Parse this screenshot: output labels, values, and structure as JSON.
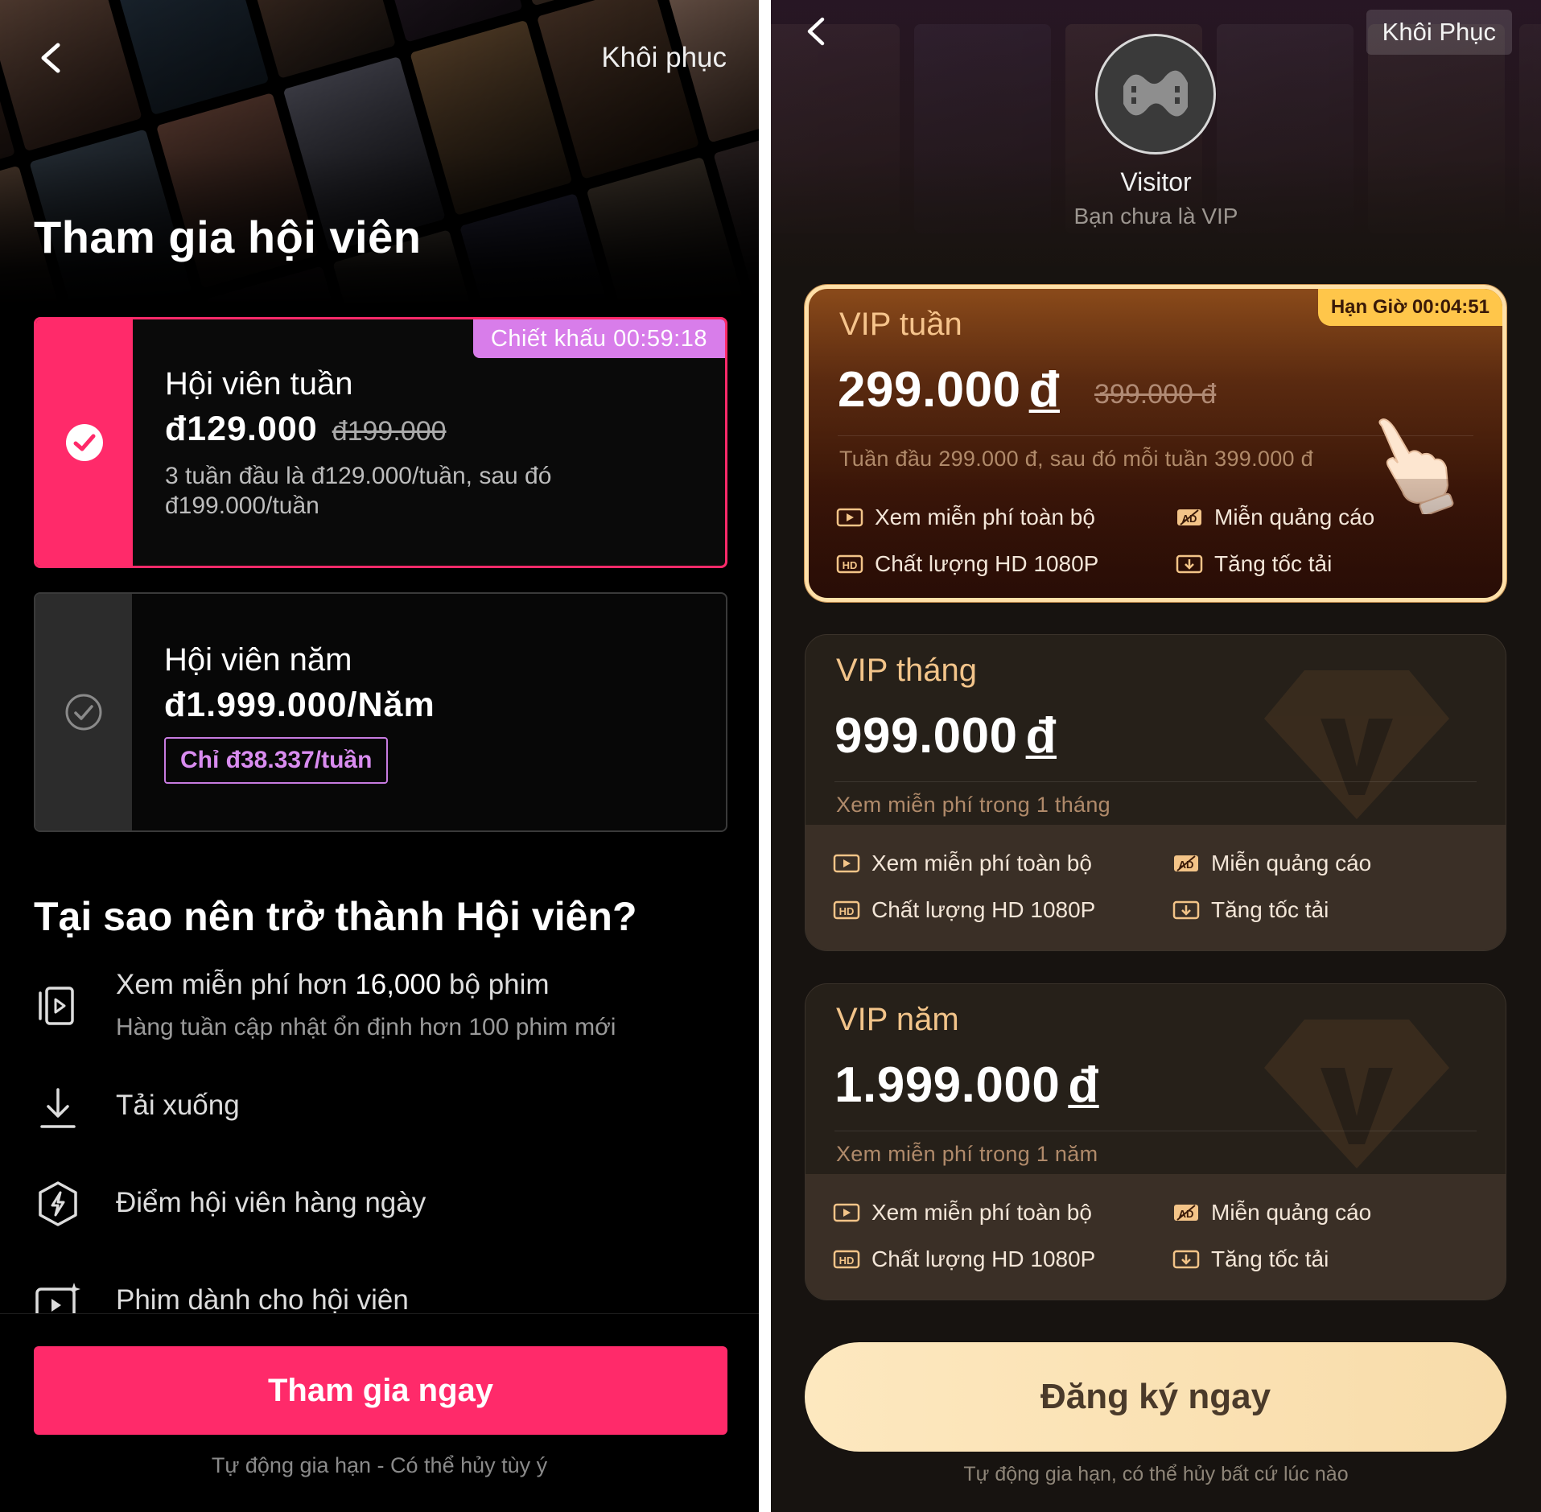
{
  "left": {
    "restore_label": "Khôi phục",
    "title": "Tham gia hội viên",
    "plans": [
      {
        "name": "Hội viên tuần",
        "price": "đ129.000",
        "old_price": "đ199.000",
        "description": "3 tuần đầu là đ129.000/tuần, sau đó đ199.000/tuần",
        "discount_tag": "Chiết khấu 00:59:18",
        "selected": true
      },
      {
        "name": "Hội viên năm",
        "price": "đ1.999.000/Năm",
        "per_week": "Chỉ đ38.337/tuần",
        "selected": false
      }
    ],
    "why_title": "Tại sao nên trở thành Hội viên?",
    "benefits": [
      {
        "pre": "Xem miễn phí hơn ",
        "strong": "16,000",
        "post": " bộ phim",
        "sub": "Hàng tuần cập nhật ổn định hơn 100 phim mới",
        "icon": "video-library-icon"
      },
      {
        "text": "Tải xuống",
        "icon": "download-icon"
      },
      {
        "text": "Điểm hội viên hàng ngày",
        "icon": "points-badge-icon"
      },
      {
        "text": "Phim dành cho hội viên",
        "icon": "exclusive-video-icon"
      }
    ],
    "join_button": "Tham gia ngay",
    "auto_renew": "Tự động gia hạn - Có thể hủy tùy ý",
    "colors": {
      "accent": "#ff2a6a",
      "tag": "#d87dea"
    }
  },
  "right": {
    "restore_label": "Khôi Phục",
    "username": "Visitor",
    "vip_status": "Bạn chưa là VIP",
    "plans": [
      {
        "name": "VIP tuần",
        "price": "299.000",
        "currency": "đ",
        "old_price": "399.000 đ",
        "subtitle": "Tuần đầu 299.000 đ, sau đó mỗi tuần 399.000 đ",
        "deadline_tag": "Hạn Giờ 00:04:51",
        "selected": true
      },
      {
        "name": "VIP tháng",
        "price": "999.000",
        "currency": "đ",
        "subtitle": "Xem miễn phí trong 1 tháng",
        "selected": false
      },
      {
        "name": "VIP năm",
        "price": "1.999.000",
        "currency": "đ",
        "subtitle": "Xem miễn phí trong 1 năm",
        "selected": false
      }
    ],
    "features": {
      "watch_free": "Xem miễn phí toàn bộ",
      "no_ads": "Miễn quảng cáo",
      "hd": "Chất lượng HD 1080P",
      "fast_download": "Tăng tốc tải"
    },
    "register_button": "Đăng ký ngay",
    "auto_renew": "Tự động gia hạn, có thể hủy bất cứ lúc nào",
    "colors": {
      "gold": "#ffe0a8",
      "button": "#fbe3b6",
      "deadline": "#ffc64a"
    }
  }
}
